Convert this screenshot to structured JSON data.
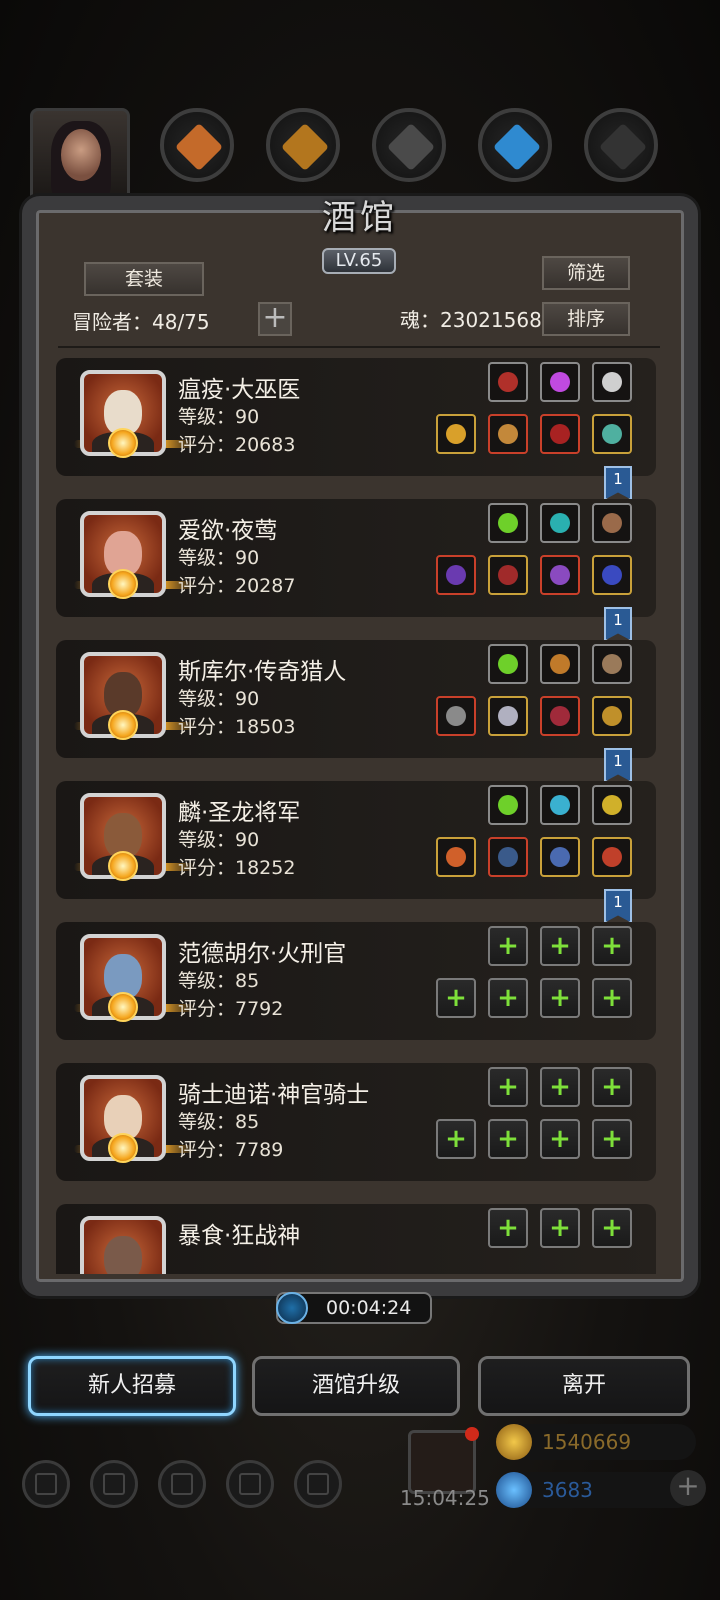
{
  "title": "酒馆",
  "level": "LV.65",
  "buttons": {
    "set": "套装",
    "filter": "筛选",
    "sort": "排序"
  },
  "stats": {
    "adventurers_label": "冒险者：48/75",
    "soul_label": "魂：23021568"
  },
  "heroes": [
    {
      "name": "瘟疫·大巫医",
      "level": "等级：90",
      "score": "评分：20683",
      "bookmark": "1"
    },
    {
      "name": "爱欲·夜莺",
      "level": "等级：90",
      "score": "评分：20287",
      "bookmark": "1"
    },
    {
      "name": "斯库尔·传奇猎人",
      "level": "等级：90",
      "score": "评分：18503",
      "bookmark": "1"
    },
    {
      "name": "麟·圣龙将军",
      "level": "等级：90",
      "score": "评分：18252",
      "bookmark": "1"
    },
    {
      "name": "范德胡尔·火刑官",
      "level": "等级：85",
      "score": "评分：7792"
    },
    {
      "name": "骑士迪诺·神官骑士",
      "level": "等级：85",
      "score": "评分：7789"
    },
    {
      "name": "暴食·狂战神"
    }
  ],
  "timer": "00:04:24",
  "bottom_buttons": {
    "recruit": "新人招募",
    "upgrade": "酒馆升级",
    "leave": "离开"
  },
  "hud": {
    "time": "15:04:25",
    "gold": "1540669",
    "gems": "3683"
  },
  "colors": {
    "accent_blue": "#8fd6ff",
    "equip_green_plus": "#7ee03a",
    "bookmark_blue": "#2a5a94"
  }
}
